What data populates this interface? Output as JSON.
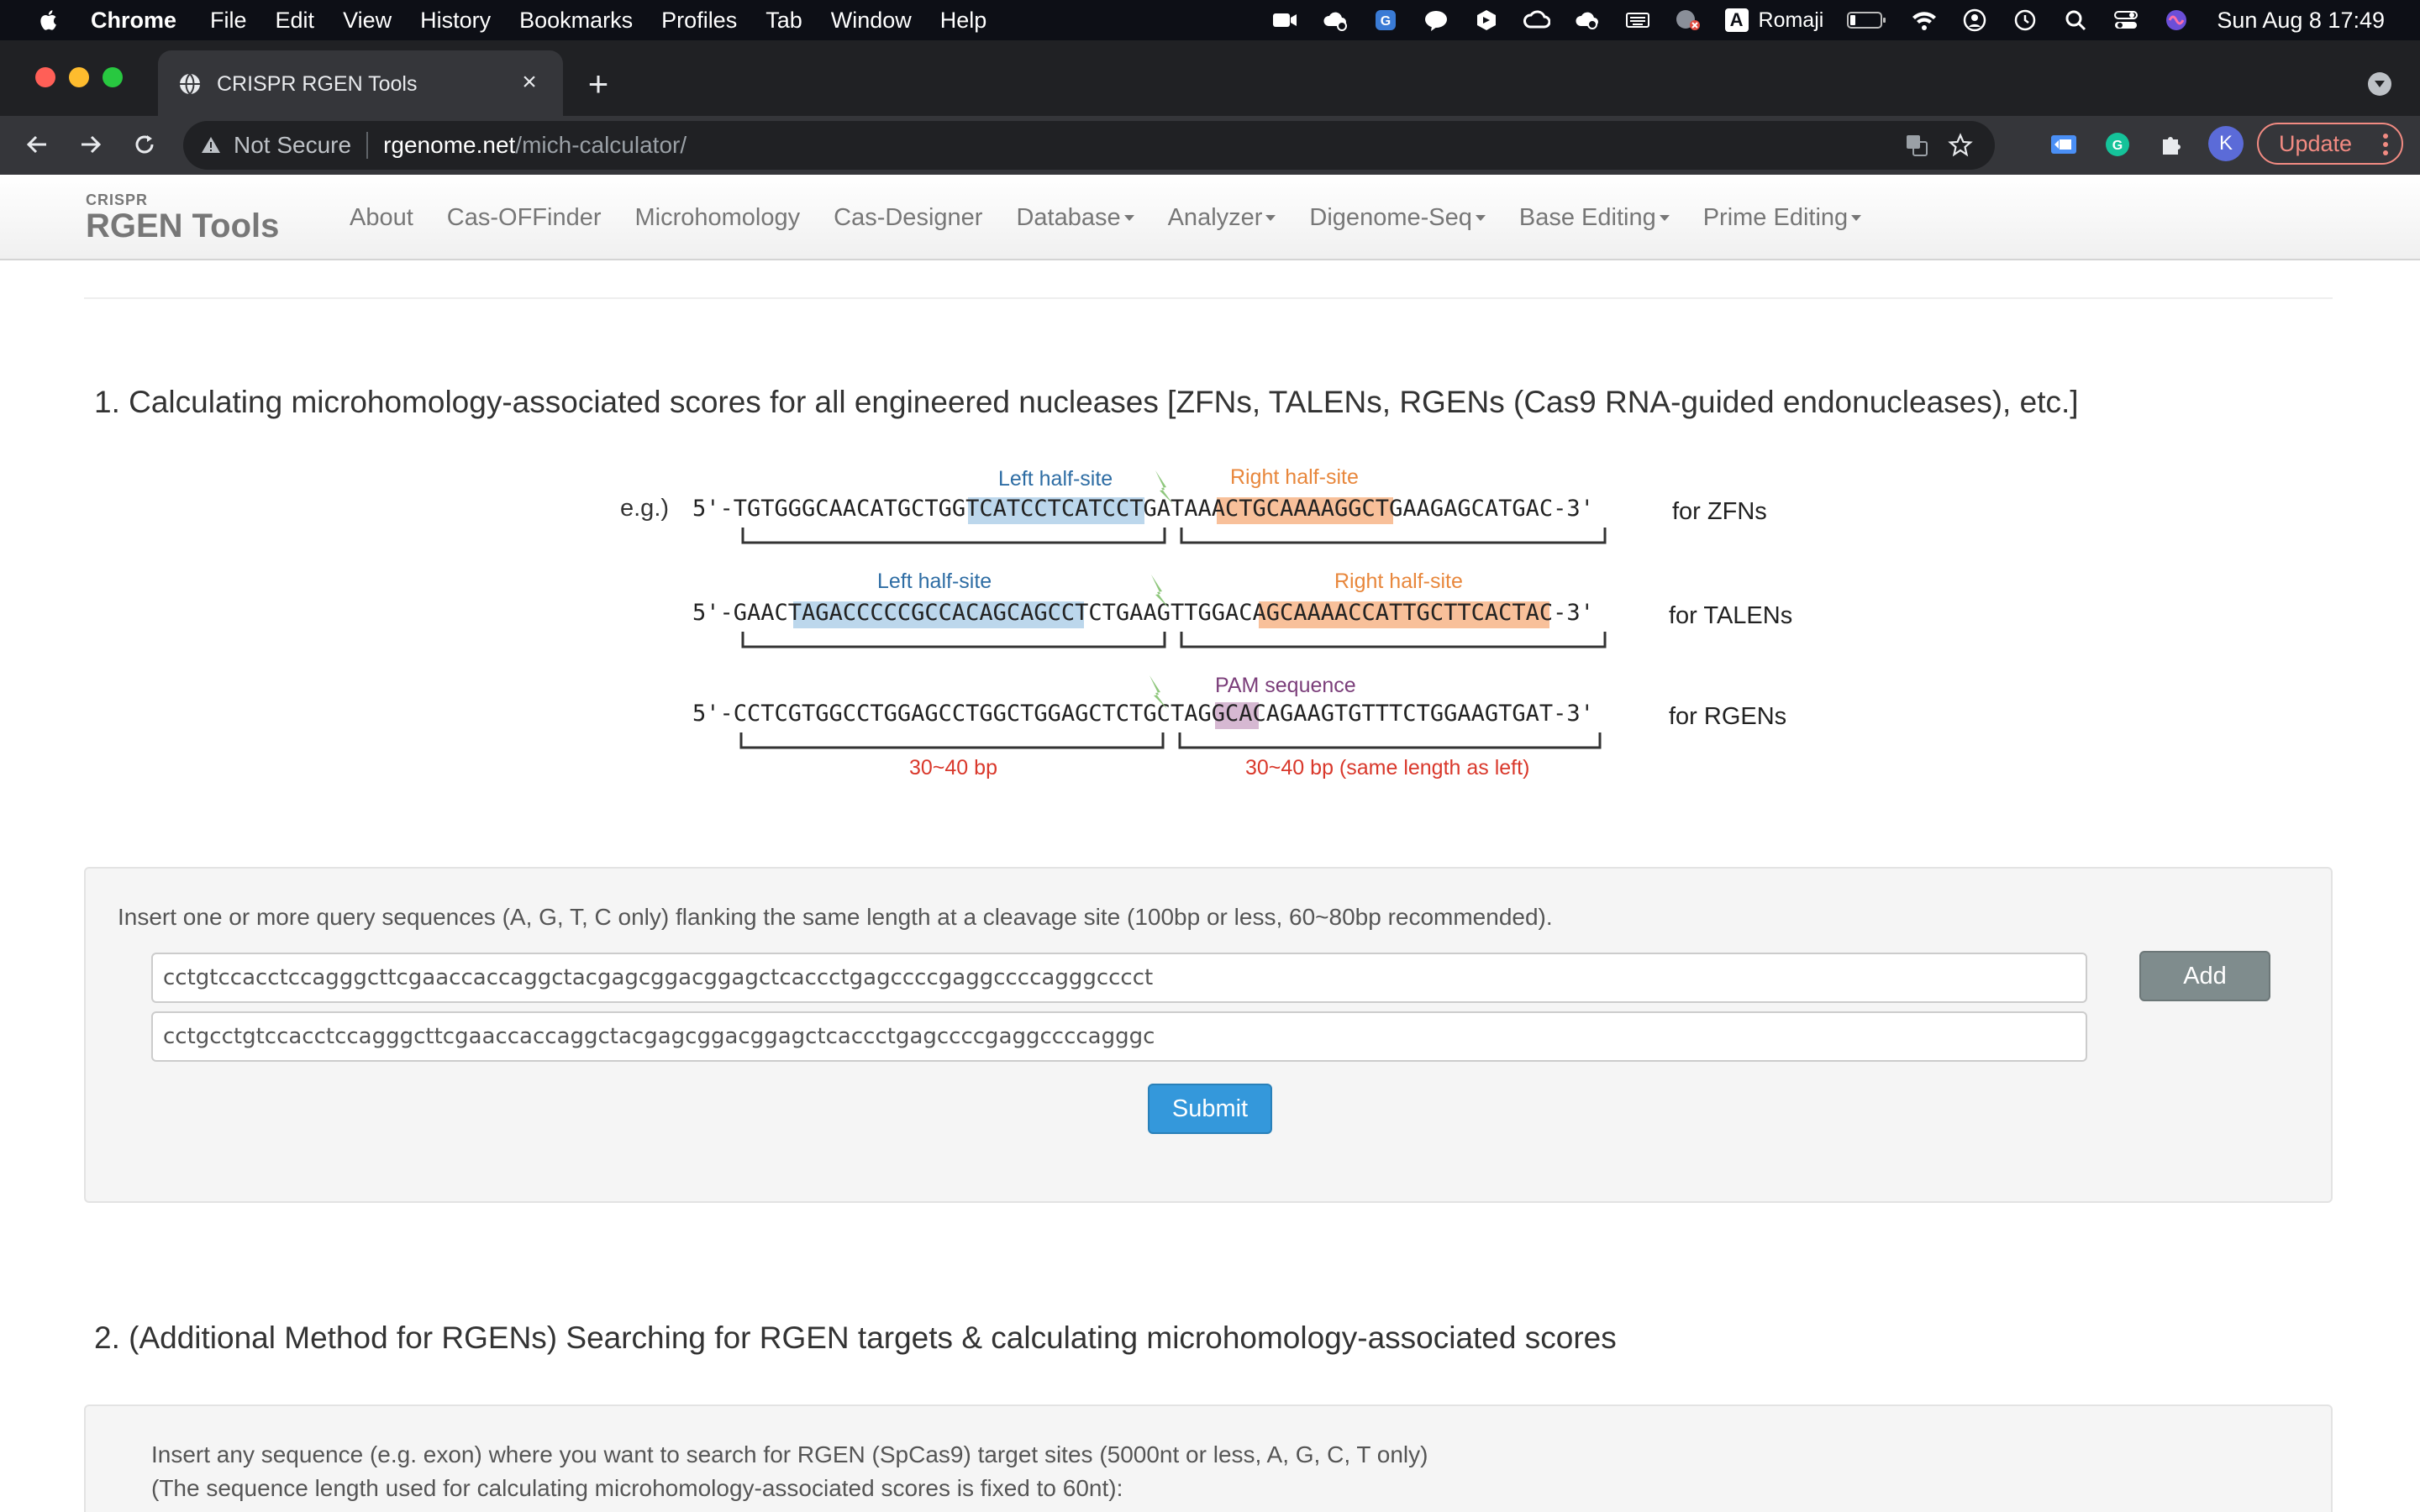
{
  "menubar": {
    "app": "Chrome",
    "items": [
      "File",
      "Edit",
      "View",
      "History",
      "Bookmarks",
      "Profiles",
      "Tab",
      "Window",
      "Help"
    ],
    "ime_label": "Romaji",
    "ime_badge": "A",
    "clock": "Sun Aug 8  17:49"
  },
  "browser": {
    "tab_title": "CRISPR RGEN Tools",
    "tab_close": "×",
    "new_tab": "+",
    "security_label": "Not Secure",
    "url_host": "rgenome.net",
    "url_path": "/mich-calculator/",
    "avatar_letter": "K",
    "update_label": "Update"
  },
  "site": {
    "brand_small": "CRISPR",
    "brand_big": "RGEN Tools",
    "nav": [
      {
        "label": "About",
        "dropdown": false
      },
      {
        "label": "Cas-OFFinder",
        "dropdown": false
      },
      {
        "label": "Microhomology",
        "dropdown": false
      },
      {
        "label": "Cas-Designer",
        "dropdown": false
      },
      {
        "label": "Database",
        "dropdown": true
      },
      {
        "label": "Analyzer",
        "dropdown": true
      },
      {
        "label": "Digenome-Seq",
        "dropdown": true
      },
      {
        "label": "Base Editing",
        "dropdown": true
      },
      {
        "label": "Prime Editing",
        "dropdown": true
      }
    ]
  },
  "section1": {
    "title": "1. Calculating microhomology-associated scores for all engineered nucleases [ZFNs, TALENs, RGENs (Cas9 RNA-guided endonucleases), etc.]",
    "figure": {
      "eg": "e.g.)",
      "zfn": {
        "prefix": "5'-TGTGGGCAACATGCTG",
        "left": "GTCATCCTCATC",
        "mid": "CTGAT",
        "right": "AAACTGCAAAAG",
        "suffix": "GCTGAAGAGCATGAC-3'",
        "label": "for ZFNs",
        "left_label": "Left half-site",
        "right_label": "Right half-site"
      },
      "talen": {
        "prefix": "5'-GAAC",
        "left": "TAGACCCCCGCCACAGCAGC",
        "mid": "CTCTGAAGTTGG",
        "right": "ACAGCAAAACCATTGCTTCA",
        "suffix": "CTAC-3'",
        "label": "for TALENs",
        "left_label": "Left half-site",
        "right_label": "Right half-site"
      },
      "rgen": {
        "prefix": "5'-CCTCGTGGCCTGGAGCCTGGCTGGAGCTCTGCT",
        "pam": "AGG",
        "suffix": "CACAGAAGTGTTTCTGGAAGTGAT-3'",
        "label": "for RGENs",
        "pam_label": "PAM sequence",
        "left_len": "30~40 bp",
        "right_len": "30~40 bp (same length as left)"
      }
    },
    "instruction": "Insert one or more query sequences (A, G, T, C only) flanking the same length at a cleavage site (100bp or less, 60~80bp recommended).",
    "inputs": [
      "cctgtccacctccagggcttcgaaccaccaggctacgagcggacggagctcaccctgagccccgaggccccagggcccct",
      "cctgcctgtccacctccagggcttcgaaccaccaggctacgagcggacggagctcaccctgagccccgaggccccagggc"
    ],
    "add_label": "Add",
    "submit_label": "Submit"
  },
  "section2": {
    "title": "2. (Additional Method for RGENs) Searching for RGEN targets & calculating microhomology-associated scores",
    "instruction_line1": "Insert any sequence (e.g. exon) where you want to search for RGEN (SpCas9) target sites (5000nt or less, A, G, C, T only)",
    "instruction_line2": "(The sequence length used for calculating microhomology-associated scores is fixed to 60nt):"
  },
  "colors": {
    "left_highlight": "#bcd7ec",
    "right_highlight": "#f8c09a",
    "pam_highlight": "#d6b8d2",
    "left_label": "#2e6da4",
    "right_label": "#e8873c",
    "pam_label": "#7b3e7a",
    "length_label": "#d9382b",
    "bolt": "#8fc77d"
  }
}
